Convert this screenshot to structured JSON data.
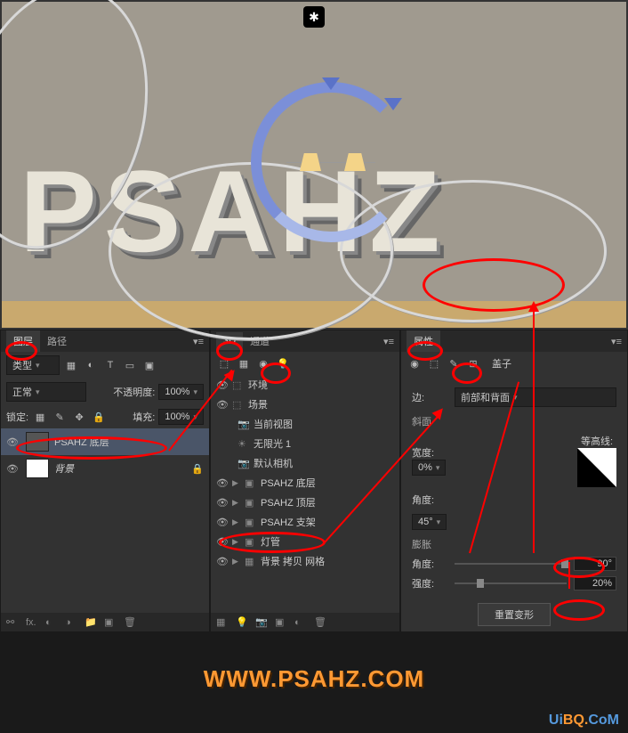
{
  "viewport": {
    "text3d": "PSAHZ",
    "top_icon": "✱"
  },
  "layers_panel": {
    "tab1": "图层",
    "tab2": "路径",
    "kind_label": "类型",
    "blend_mode": "正常",
    "opacity_label": "不透明度:",
    "opacity_value": "100%",
    "lock_label": "锁定:",
    "fill_label": "填充:",
    "fill_value": "100%",
    "layer1": "PSAHZ 底层",
    "layer2": "背景",
    "footer_fx": "fx."
  },
  "d3_panel": {
    "tab1": "3D",
    "tab2": "通道",
    "items": {
      "env": "环境",
      "scene": "场景",
      "view": "当前视图",
      "light": "无限光 1",
      "camera": "默认相机",
      "bottom": "PSAHZ 底层",
      "top": "PSAHZ 顶层",
      "frame": "PSAHZ 支架",
      "tube": "灯管",
      "bg": "背景 拷贝 网格"
    }
  },
  "props_panel": {
    "tab1": "属性",
    "cap_label": "盖子",
    "edge_label": "边:",
    "edge_value": "前部和背面",
    "bevel_section": "斜面",
    "width_label": "宽度:",
    "width_value": "0%",
    "contour_label": "等高线:",
    "angle_label": "角度:",
    "angle_value": "45°",
    "inflate_section": "膨胀",
    "inf_angle_label": "角度:",
    "inf_angle_value": "90°",
    "strength_label": "强度:",
    "strength_value": "20%",
    "reset_btn": "重置变形"
  },
  "watermark": "WWW.PSAHZ.COM",
  "watermark2_a": "Ui",
  "watermark2_b": "BQ.",
  "watermark2_c": "CoM"
}
